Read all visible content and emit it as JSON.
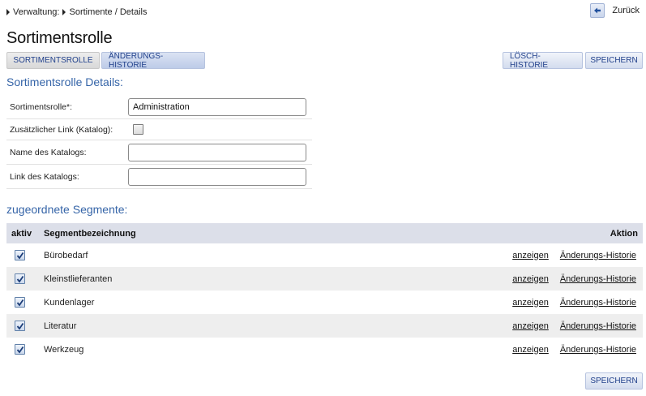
{
  "breadcrumb": [
    "Verwaltung:",
    "Sortimente / Details"
  ],
  "back_label": "Zurück",
  "title": "Sortimentsrolle",
  "tabs": {
    "sortimentsrolle": "SORTIMENTSROLLE",
    "aenderungs_historie": "ÄNDERUNGS-HISTORIE"
  },
  "actions": {
    "loesch_historie": "LÖSCH-HISTORIE",
    "speichern": "SPEICHERN"
  },
  "details": {
    "heading": "Sortimentsrolle Details:",
    "fields": [
      {
        "label": "Sortimentsrolle*:",
        "value": "Administration"
      },
      {
        "label": "Zusätzlicher Link (Katalog):",
        "checked": false
      },
      {
        "label": "Name des Katalogs:",
        "value": ""
      },
      {
        "label": "Link des Katalogs:",
        "value": ""
      }
    ]
  },
  "segments": {
    "heading": "zugeordnete Segmente:",
    "columns": {
      "aktiv": "aktiv",
      "name": "Segmentbezeichnung",
      "aktion": "Aktion"
    },
    "action_show": "anzeigen",
    "action_history": "Änderungs-Historie",
    "rows": [
      {
        "name": "Bürobedarf",
        "active": true
      },
      {
        "name": "Kleinstlieferanten",
        "active": true
      },
      {
        "name": "Kundenlager",
        "active": true
      },
      {
        "name": "Literatur",
        "active": true
      },
      {
        "name": "Werkzeug",
        "active": true
      }
    ]
  },
  "footer": {
    "speichern": "SPEICHERN"
  }
}
